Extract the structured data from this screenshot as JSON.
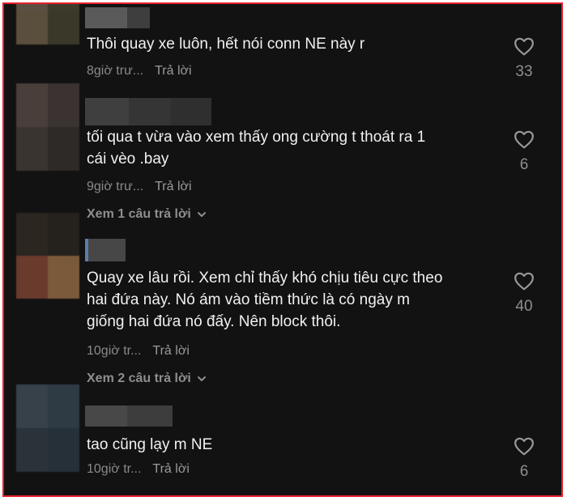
{
  "comments": [
    {
      "text": "Thôi quay xe luôn, hết nói conn NE này r",
      "time": "8giờ trư...",
      "reply": "Trả lời",
      "likes": "33",
      "view_replies": ""
    },
    {
      "text": "tối qua t vừa vào xem thấy ong cường t thoát ra 1\ncái vèo .bay",
      "time": "9giờ trư...",
      "reply": "Trả lời",
      "likes": "6",
      "view_replies": "Xem 1 câu trả lời"
    },
    {
      "text": "Quay xe lâu rồi. Xem chỉ thấy khó chịu tiêu cực theo\nhai đứa này. Nó ám vào tiềm thức là có ngày m\ngiống hai đứa nó đấy. Nên block thôi.",
      "time": "10giờ tr...",
      "reply": "Trả lời",
      "likes": "40",
      "view_replies": "Xem 2 câu trả lời"
    },
    {
      "text": "tao cũng lạy m NE",
      "time": "10giờ tr...",
      "reply": "Trả lời",
      "likes": "6",
      "view_replies": ""
    }
  ],
  "colors": {
    "background": "#121212",
    "border": "#e8202a",
    "text": "#f1f1f1",
    "muted": "#8a8a8a"
  },
  "icons": {
    "like": "heart-outline-icon",
    "expand": "chevron-down-icon",
    "avatar": "blurred-avatar",
    "username": "blurred-username"
  }
}
